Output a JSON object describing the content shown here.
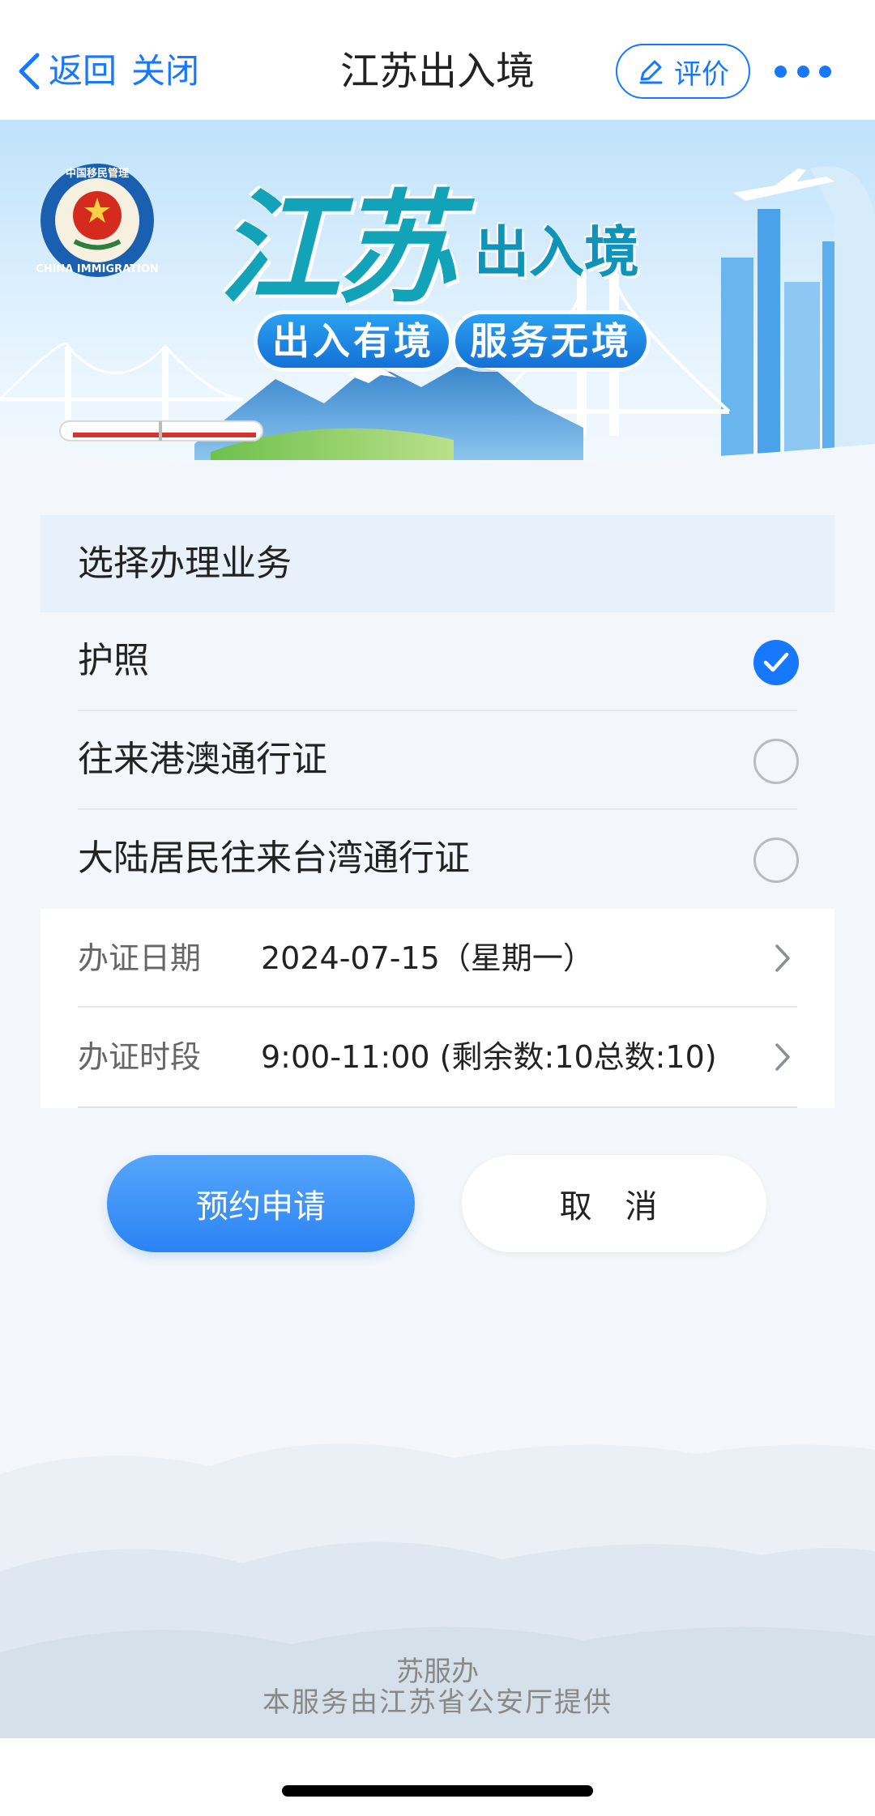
{
  "nav": {
    "back_label": "返回",
    "close_label": "关闭",
    "title": "江苏出入境",
    "rate_label": "评价"
  },
  "banner": {
    "title": "江苏",
    "subtitle": "出入境",
    "slogan_left": "出入有境",
    "slogan_right": "服务无境",
    "logo_text_top": "中国移民管理",
    "logo_text_bottom": "CHINA IMMIGRATION"
  },
  "business": {
    "header": "选择办理业务",
    "options": [
      {
        "label": "护照",
        "selected": true
      },
      {
        "label": "往来港澳通行证",
        "selected": false
      },
      {
        "label": "大陆居民往来台湾通行证",
        "selected": false
      }
    ]
  },
  "appointment": {
    "date_label": "办证日期",
    "date_value": "2024-07-15（星期一）",
    "slot_label": "办证时段",
    "slot_value": "9:00-11:00 (剩余数:10总数:10)"
  },
  "actions": {
    "submit_label": "预约申请",
    "cancel_label": "取 消"
  },
  "footer": {
    "brand": "苏服办",
    "provider": "本服务由江苏省公安厅提供"
  },
  "colors": {
    "accent": "#1677ff",
    "background": "#f3f6fa",
    "section_header": "#e8f0fa"
  },
  "icons": [
    "chevron-left-icon",
    "edit-icon",
    "more-icon",
    "check-icon",
    "chevron-right-icon"
  ]
}
